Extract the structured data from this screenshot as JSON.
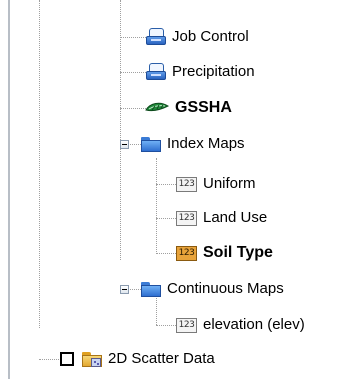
{
  "tree": {
    "items": [
      {
        "id": "job_control",
        "label": "Job Control",
        "icon": "document-icon"
      },
      {
        "id": "precipitation",
        "label": "Precipitation",
        "icon": "document-icon"
      },
      {
        "id": "gssha",
        "label": "GSSHA",
        "icon": "gssha-model-icon"
      },
      {
        "id": "index_maps",
        "label": "Index Maps",
        "icon": "folder-icon",
        "expanded": true
      },
      {
        "id": "uniform",
        "label": "Uniform",
        "icon": "dataset-123-icon"
      },
      {
        "id": "land_use",
        "label": "Land Use",
        "icon": "dataset-123-icon"
      },
      {
        "id": "soil_type",
        "label": "Soil Type",
        "icon": "dataset-123-icon",
        "active": true
      },
      {
        "id": "continuous_maps",
        "label": "Continuous Maps",
        "icon": "folder-icon",
        "expanded": true
      },
      {
        "id": "elevation",
        "label": "elevation (elev)",
        "icon": "dataset-123-icon"
      },
      {
        "id": "scatter",
        "label": "2D Scatter Data",
        "icon": "scatter-folder-icon",
        "checked": false
      }
    ],
    "icon_text_123": "123"
  },
  "colors": {
    "tree_lines": "#a0a0a0",
    "folder_blue": "#3a7bd5",
    "active_dataset": "#e8a33a",
    "gssha_green": "#1f8a3a"
  }
}
